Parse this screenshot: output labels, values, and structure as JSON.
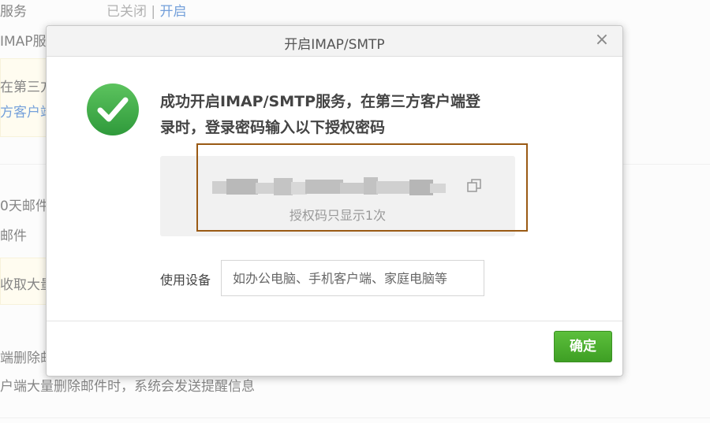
{
  "background": {
    "row1_label": "服务",
    "row1_status": "已关闭",
    "row1_sep": "|",
    "row1_action": "开启",
    "row2_label": "IMAP服",
    "note1_line1": "在第三方",
    "note1_line2": "方客户端",
    "row3_line1": "0天邮件",
    "row3_line2": "邮件",
    "note2_line1": "收取大量",
    "row4_line1": "端删除邮",
    "row4_line2": "户端大量删除邮件时，系统会发送提醒信息"
  },
  "dialog": {
    "title": "开启IMAP/SMTP",
    "close_symbol": "×",
    "success_icon": "check-circle-icon",
    "success_message_line1": "成功开启IMAP/SMTP服务，在第三方客户端登",
    "success_message_line2": "录时，登录密码输入以下授权密码",
    "auth_code_hint": "授权码只显示1次",
    "copy_icon": "copy-icon",
    "device_label": "使用设备",
    "device_placeholder": "如办公电脑、手机客户端、家庭电脑等",
    "device_value": "",
    "confirm_button": "确定"
  },
  "colors": {
    "success_green": "#3aa84a",
    "button_green": "#4caf32",
    "highlight_border": "#9a5a14",
    "link_blue": "#2a6ec7"
  }
}
